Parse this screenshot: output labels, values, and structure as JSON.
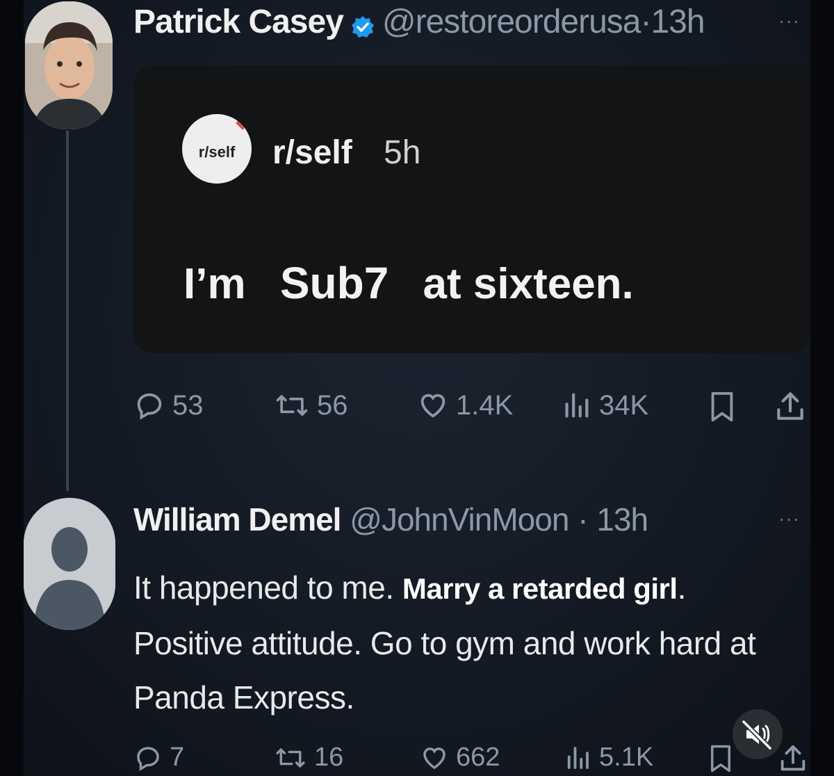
{
  "tweet1": {
    "author_name": "Patrick Casey",
    "handle": "@restoreorderusa",
    "separator": "·",
    "time": "13h",
    "more_label": "···",
    "quote": {
      "subreddit_avatar_text": "r/self",
      "subreddit": "r/self",
      "time": "5h",
      "text_before": "I’m",
      "text_censor": "Sub7",
      "text_after": "at sixteen."
    },
    "stats": {
      "replies": "53",
      "reposts": "56",
      "likes": "1.4K",
      "views": "34K"
    }
  },
  "tweet2": {
    "author_name": "William Demel",
    "handle": "@JohnVinMoon",
    "separator": "·",
    "time": "13h",
    "more_label": "···",
    "body_before": "It happened to me. ",
    "body_highlight": "Marry a retarded girl",
    "body_after": ". Positive attitude. Go to gym and work hard at Panda Express.",
    "stats": {
      "replies": "7",
      "reposts": "16",
      "likes": "662",
      "views": "5.1K"
    }
  },
  "colors": {
    "background": "#141a24",
    "card": "#131416",
    "verified_badge": "#1d9bf0",
    "muted_text": "#8b98a5"
  }
}
